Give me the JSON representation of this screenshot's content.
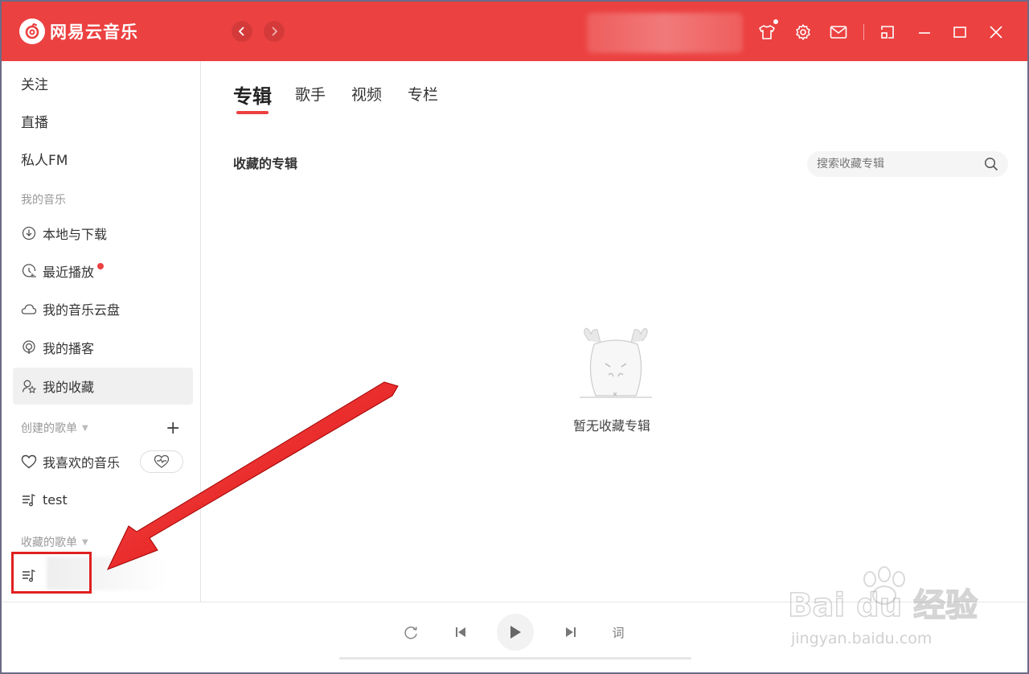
{
  "app": {
    "name": "网易云音乐",
    "brand_color": "#ec4141"
  },
  "sidebar": {
    "top_items": [
      {
        "label": "关注"
      },
      {
        "label": "直播"
      },
      {
        "label": "私人FM"
      }
    ],
    "my_music_title": "我的音乐",
    "my_music_items": [
      {
        "label": "本地与下载",
        "icon": "download-icon"
      },
      {
        "label": "最近播放",
        "icon": "recent-play-icon"
      },
      {
        "label": "我的音乐云盘",
        "icon": "cloud-icon"
      },
      {
        "label": "我的播客",
        "icon": "podcast-icon"
      },
      {
        "label": "我的收藏",
        "icon": "favorite-icon"
      }
    ],
    "created_title": "创建的歌单",
    "created_playlists": [
      {
        "label": "我喜欢的音乐",
        "icon": "heart-icon"
      },
      {
        "label": "test",
        "icon": "playlist-icon"
      }
    ],
    "collected_title": "收藏的歌单"
  },
  "main": {
    "tabs": [
      {
        "label": "专辑"
      },
      {
        "label": "歌手"
      },
      {
        "label": "视频"
      },
      {
        "label": "专栏"
      }
    ],
    "section_title": "收藏的专辑",
    "search_placeholder": "搜索收藏专辑",
    "empty_text": "暂无收藏专辑"
  },
  "player": {
    "lyrics_label": "词"
  },
  "watermark": {
    "brand": "Bai du 经验",
    "url": "jingyan.baidu.com"
  }
}
